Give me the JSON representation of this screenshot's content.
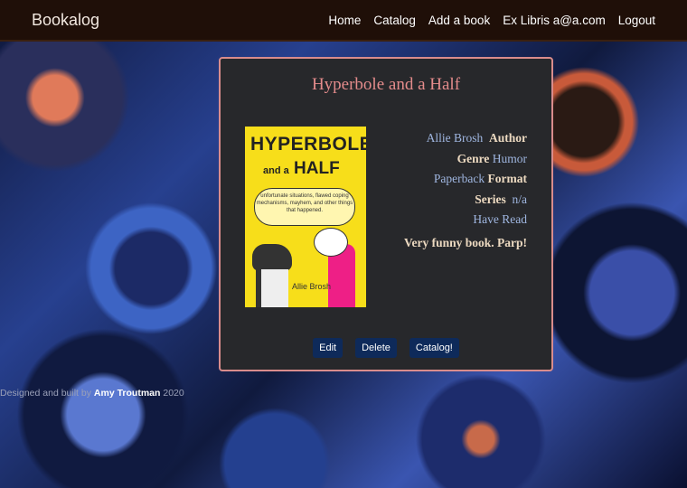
{
  "nav": {
    "brand": "Bookalog",
    "links": [
      "Home",
      "Catalog",
      "Add a book",
      "Ex Libris a@a.com",
      "Logout"
    ]
  },
  "book": {
    "title": "Hyperbole and a Half",
    "cover": {
      "line1": "HYPERBOLE",
      "line2_small": "and a",
      "line2": "HALF",
      "blurb": "unfortunate situations, flawed coping mechanisms, mayhem, and other things that happened.",
      "author": "Allie Brosh"
    },
    "author": "Allie Brosh",
    "author_label": "Author",
    "genre_label": "Genre",
    "genre": "Humor",
    "format": "Paperback",
    "format_label": "Format",
    "series_label": "Series",
    "series": "n/a",
    "status": "Have Read",
    "notes": "Very funny book. Parp!"
  },
  "actions": {
    "edit": "Edit",
    "delete": "Delete",
    "catalog": "Catalog!"
  },
  "footer": {
    "prefix": "Designed and built by",
    "name": "Amy Troutman",
    "year": "2020"
  },
  "colors": {
    "navbar": "#1f0f08",
    "card": "#27282b",
    "card_border": "#d98c8c",
    "title": "#e58c8c",
    "button": "#0e2a5a"
  }
}
